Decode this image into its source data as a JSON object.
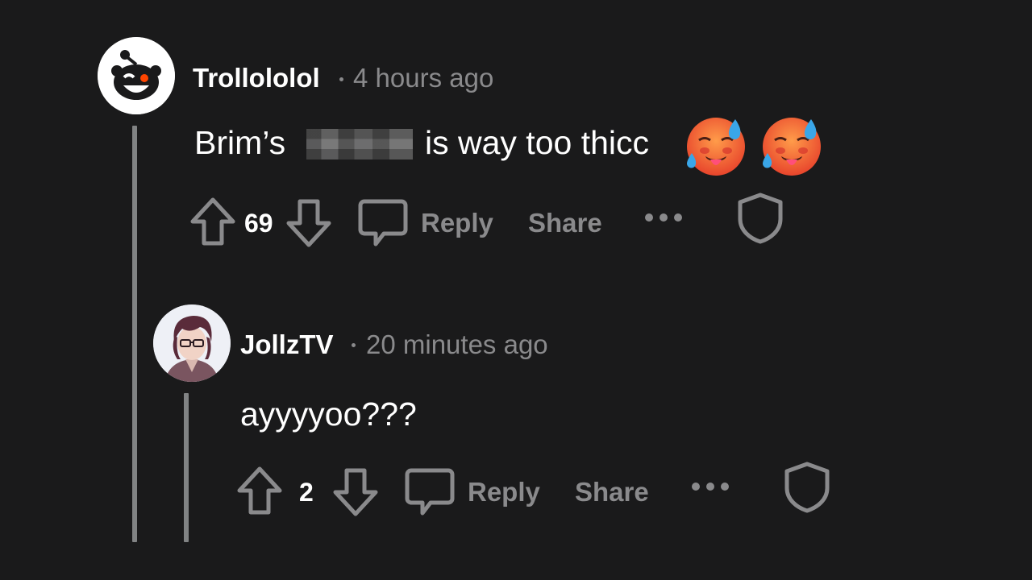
{
  "comments": [
    {
      "username": "Trollololol",
      "time": "4 hours ago",
      "text_before": "Brim’s",
      "text_after": "is way too thicc",
      "emoji": [
        "hot-face-emoji",
        "hot-face-emoji"
      ],
      "score": "69",
      "reply_label": "Reply",
      "share_label": "Share",
      "more_label": "•••"
    },
    {
      "username": "JollzTV",
      "time": "20 minutes ago",
      "text": "ayyyyoo???",
      "score": "2",
      "reply_label": "Reply",
      "share_label": "Share",
      "more_label": "•••"
    }
  ],
  "icons": {
    "upvote": "arrow-up-icon",
    "downvote": "arrow-down-icon",
    "reply": "speech-bubble-icon",
    "more": "more-dots-icon",
    "shield": "shield-icon"
  },
  "colors": {
    "background": "#1a1a1b",
    "muted": "#8a8a8c",
    "text": "#ffffff",
    "thread_line": "#818384"
  }
}
